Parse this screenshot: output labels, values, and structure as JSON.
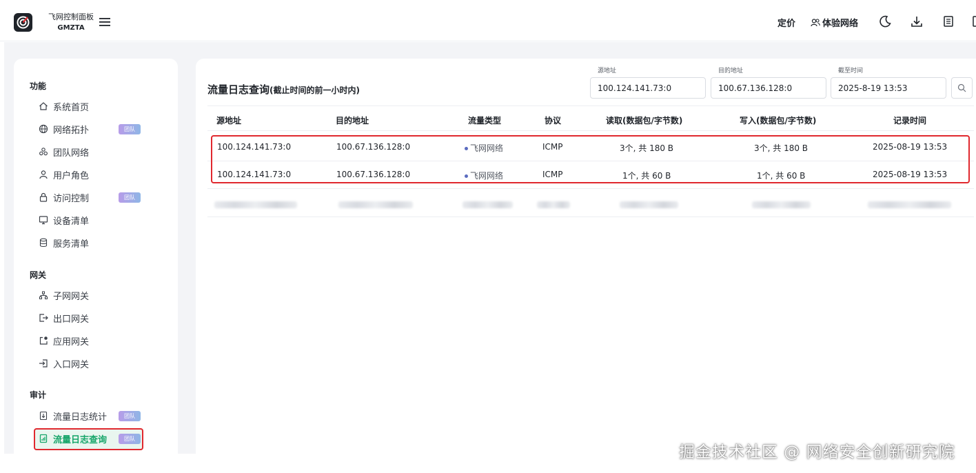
{
  "header": {
    "brand_name": "飞网控制面板",
    "brand_code": "GMZTA",
    "pricing_label": "定价",
    "try_label": "体验网络"
  },
  "sidebar": {
    "sections": [
      {
        "title": "功能"
      },
      {
        "title": "网关"
      },
      {
        "title": "审计"
      }
    ],
    "badge_label": "团队",
    "items": [
      {
        "label": "系统首页",
        "icon": "home-icon"
      },
      {
        "label": "网络拓扑",
        "icon": "globe-icon"
      },
      {
        "label": "团队网络",
        "icon": "cluster-icon"
      },
      {
        "label": "用户角色",
        "icon": "user-icon"
      },
      {
        "label": "访问控制",
        "icon": "lock-icon"
      },
      {
        "label": "设备清单",
        "icon": "monitor-icon"
      },
      {
        "label": "服务清单",
        "icon": "database-icon"
      },
      {
        "label": "子网网关",
        "icon": "subnet-icon"
      },
      {
        "label": "出口网关",
        "icon": "exit-icon"
      },
      {
        "label": "应用网关",
        "icon": "app-icon"
      },
      {
        "label": "入口网关",
        "icon": "entry-icon"
      },
      {
        "label": "流量日志统计",
        "icon": "download-doc-icon"
      },
      {
        "label": "流量日志查询",
        "icon": "chart-doc-icon"
      }
    ]
  },
  "main": {
    "title": "流量日志查询",
    "title_sub": "(截止时间的前一小时内)",
    "filters": {
      "src_label": "源地址",
      "src_value": "100.124.141.73:0",
      "dst_label": "目的地址",
      "dst_value": "100.67.136.128:0",
      "time_label": "截至时间",
      "time_value": "2025-8-19 13:53"
    },
    "table": {
      "columns": [
        "源地址",
        "目的地址",
        "流量类型",
        "协议",
        "读取(数据包/字节数)",
        "写入(数据包/字节数)",
        "记录时间"
      ],
      "rows": [
        [
          "100.124.141.73:0",
          "100.67.136.128:0",
          "飞网网络",
          "ICMP",
          "3个, 共 180 B",
          "3个, 共 180 B",
          "2025-08-19 13:53"
        ],
        [
          "100.124.141.73:0",
          "100.67.136.128:0",
          "飞网网络",
          "ICMP",
          "1个, 共 60 B",
          "1个, 共 60 B",
          "2025-08-19 13:53"
        ]
      ]
    }
  },
  "watermark": "掘金技术社区 @ 网络安全创新研究院",
  "colors": {
    "accent_green": "#17a66a",
    "highlight_red": "#e0282e",
    "badge_purple": "#b79ce8"
  }
}
